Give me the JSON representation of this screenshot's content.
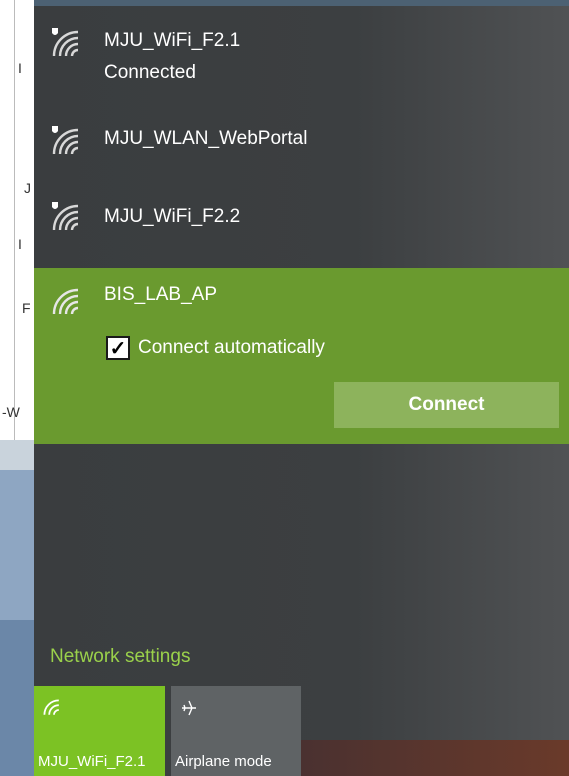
{
  "networks": [
    {
      "name": "MJU_WiFi_F2.1",
      "status": "Connected",
      "secured": true
    },
    {
      "name": "MJU_WLAN_WebPortal",
      "status": "",
      "secured": true
    },
    {
      "name": "MJU_WiFi_F2.2",
      "status": "",
      "secured": true
    }
  ],
  "selected_network": {
    "name": "BIS_LAB_AP",
    "auto_connect_label": "Connect automatically",
    "auto_connect_checked": true,
    "connect_label": "Connect"
  },
  "network_settings_label": "Network settings",
  "quick_actions": [
    {
      "label": "MJU_WiFi_F2.1",
      "icon": "wifi-icon",
      "active": true
    },
    {
      "label": "Airplane mode",
      "icon": "airplane-icon",
      "active": false
    }
  ],
  "background_fragments": [
    "I",
    "J",
    "I",
    "F",
    "-W"
  ],
  "colors": {
    "accent_green": "#7cc224",
    "selected_bg": "#6a9a2f",
    "link_green": "#9ad14b",
    "panel_bg": "#3b3e40"
  }
}
